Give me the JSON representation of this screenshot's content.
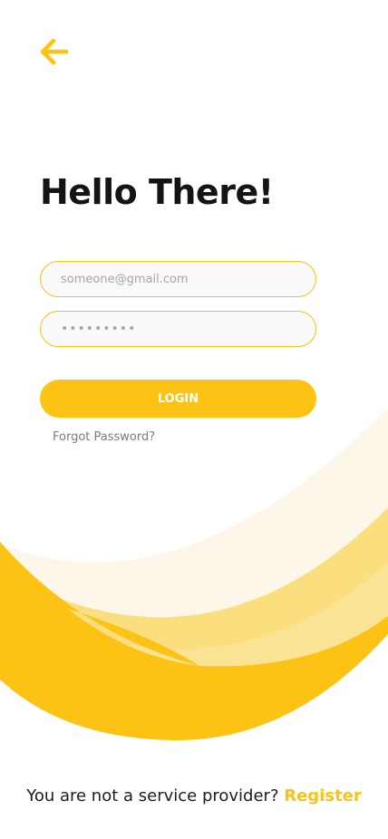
{
  "header": {
    "back_icon": "arrow-left-icon"
  },
  "title": "Hello There!",
  "email": {
    "value": "",
    "placeholder": "someone@gmail.com"
  },
  "password": {
    "value": "•••••••••",
    "placeholder": "•••••••••"
  },
  "login_label": "LOGIN",
  "forgot_password": "Forgot Password?",
  "footer": {
    "prompt": "You are not a service provider?",
    "register_label": "Register"
  },
  "colors": {
    "accent": "#fcc314",
    "title": "#141414",
    "wave_light": "#fdf7e9",
    "wave_mid": "#fbe08a",
    "wave_dark": "#fcc314"
  }
}
